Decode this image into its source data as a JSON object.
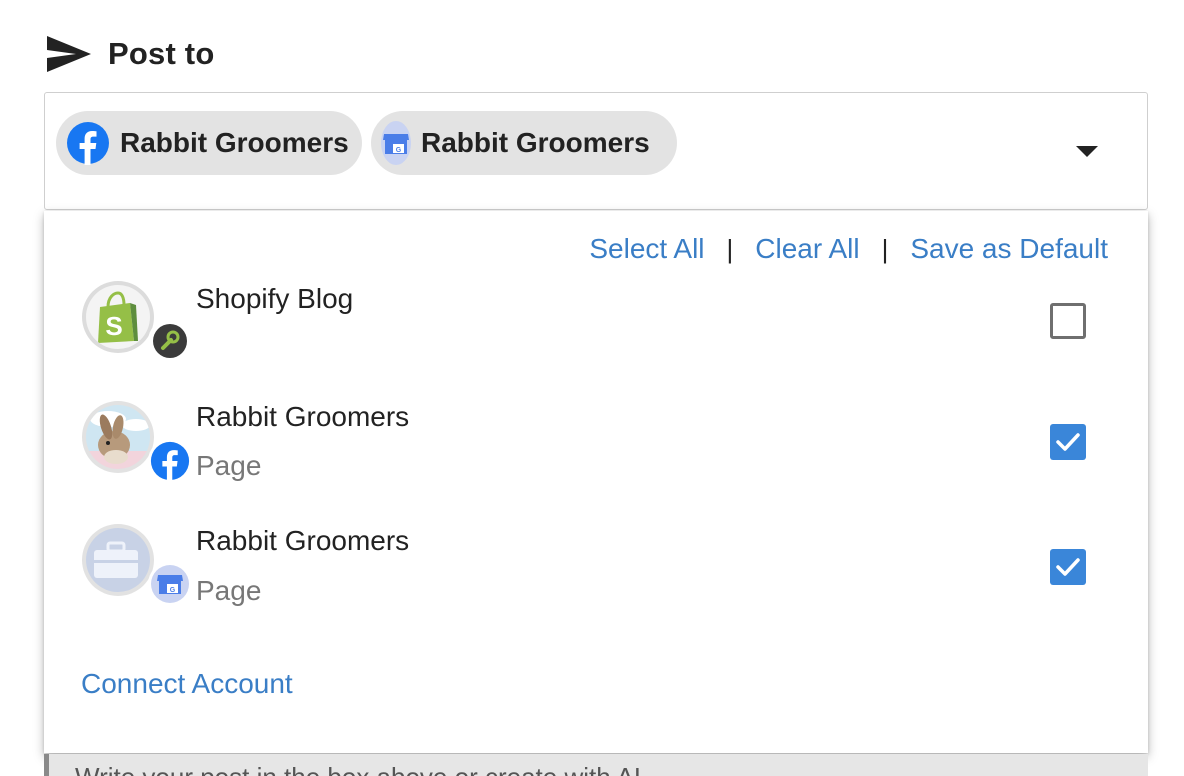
{
  "header": {
    "title": "Post to",
    "icon": "send-icon"
  },
  "selected_chips": [
    {
      "label": "Rabbit Groomers",
      "icon": "facebook-icon",
      "color": "#1877f2"
    },
    {
      "label": "Rabbit Groomers",
      "icon": "google-business-icon",
      "color": "#4a7de8"
    }
  ],
  "actions": {
    "select_all": "Select All",
    "separator": "|",
    "clear_all": "Clear All",
    "save_default": "Save as Default"
  },
  "accounts": [
    {
      "name": "Shopify Blog",
      "subtitle": "",
      "checked": false,
      "avatar": "shopify-icon",
      "badge": "wrench-icon"
    },
    {
      "name": "Rabbit Groomers",
      "subtitle": "Page",
      "checked": true,
      "avatar": "rabbit-photo",
      "badge": "facebook-icon"
    },
    {
      "name": "Rabbit Groomers",
      "subtitle": "Page",
      "checked": true,
      "avatar": "briefcase-icon",
      "badge": "google-business-icon"
    }
  ],
  "connect_label": "Connect Account",
  "editor_placeholder": "Write your post in the box above or create with AI",
  "colors": {
    "link": "#3a7ec6",
    "checkbox": "#3a86d9",
    "chip_bg": "#e3e3e3"
  }
}
